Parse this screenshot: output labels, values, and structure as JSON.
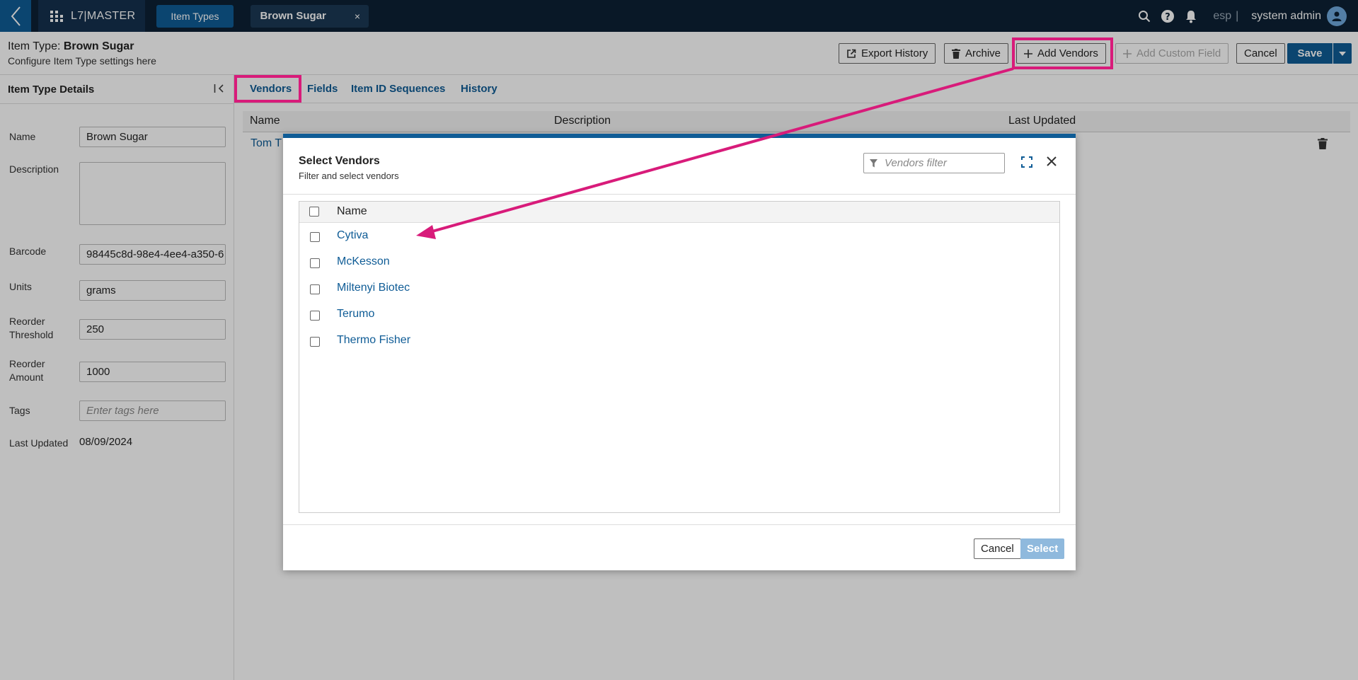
{
  "topbar": {
    "brand": "L7|MASTER",
    "tab_item_types": "Item Types",
    "tab_brown_sugar": "Brown Sugar",
    "tab_close": "×",
    "env": "esp",
    "env_sep": "|",
    "user": "system admin"
  },
  "header": {
    "title_prefix": "Item Type:",
    "title_value": "Brown Sugar",
    "subtitle": "Configure Item Type settings here",
    "export_history": "Export History",
    "archive": "Archive",
    "add_vendors": "Add Vendors",
    "add_custom_field": "Add Custom Field",
    "cancel": "Cancel",
    "save": "Save"
  },
  "left_panel": {
    "title": "Item Type Details",
    "name_label": "Name",
    "name_value": "Brown Sugar",
    "description_label": "Description",
    "barcode_label": "Barcode",
    "barcode_value": "98445c8d-98e4-4ee4-a350-6",
    "units_label": "Units",
    "units_value": "grams",
    "reorder_threshold_label_1": "Reorder",
    "reorder_threshold_label_2": "Threshold",
    "reorder_threshold_value": "250",
    "reorder_amount_label_1": "Reorder",
    "reorder_amount_label_2": "Amount",
    "reorder_amount_value": "1000",
    "tags_label": "Tags",
    "tags_placeholder": "Enter tags here",
    "last_updated_label": "Last Updated",
    "last_updated_value": "08/09/2024"
  },
  "tabs": {
    "vendors": "Vendors",
    "fields": "Fields",
    "item_id_sequences": "Item ID Sequences",
    "history": "History"
  },
  "grid": {
    "col_name": "Name",
    "col_description": "Description",
    "col_last_updated": "Last Updated",
    "row_name": "Tom T"
  },
  "modal": {
    "title": "Select Vendors",
    "subtitle": "Filter and select vendors",
    "filter_placeholder": "Vendors filter",
    "col_name": "Name",
    "vendors": [
      "Cytiva",
      "McKesson",
      "Miltenyi Biotec",
      "Terumo",
      "Thermo Fisher"
    ],
    "cancel": "Cancel",
    "select": "Select"
  },
  "colors": {
    "topbar_bg": "#0c2134",
    "accent": "#0f5c96",
    "annotation": "#d81b7a"
  }
}
